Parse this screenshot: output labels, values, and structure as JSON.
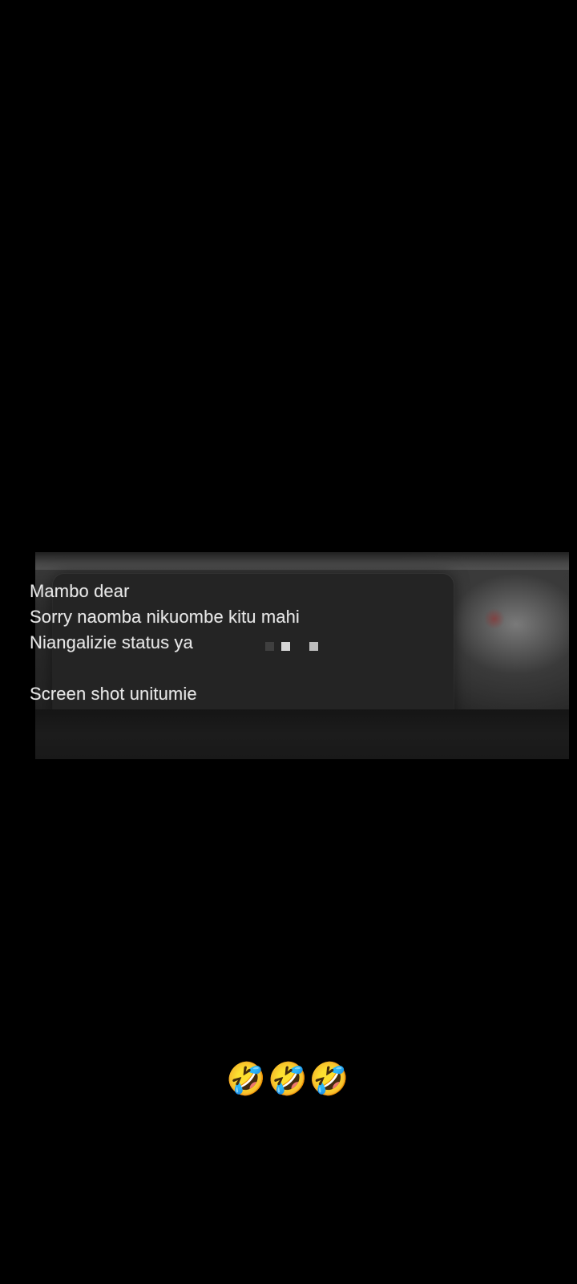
{
  "message": {
    "lines": [
      "Mambo dear",
      "Sorry naomba nikuombe kitu mahi",
      "Niangalizie status ya",
      "Screen shot unitumie"
    ]
  },
  "caption": {
    "emoji": "🤣🤣🤣"
  }
}
